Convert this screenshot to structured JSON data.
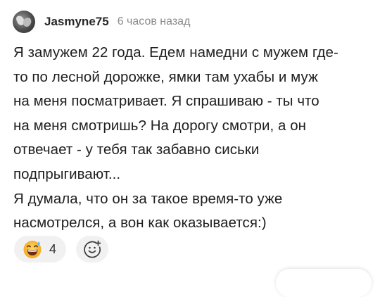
{
  "comment": {
    "author": "Jasmyne75",
    "time_ago": "6 часов назад",
    "text_lines": [
      "Я замужем 22 года. Едем намедни с мужем где-",
      "то по лесной дорожке, ямки там ухабы и муж",
      "на меня посматривает. Я спрашиваю - ты что",
      "на меня смотришь? На дорогу смотри, а он",
      "отвечает - у тебя так забавно сиськи",
      "подпрыгивают...",
      "Я думала, что он за такое время-то уже",
      "насмотрелся, а вон как оказывается:)"
    ]
  },
  "reactions": {
    "items": [
      {
        "icon": "grinning-sweat-emoji-icon",
        "count": "4"
      }
    ],
    "add_icon": "add-reaction-smiley-icon"
  },
  "colors": {
    "text": "#1f1f1f",
    "muted": "#8a8a8a",
    "pill_bg": "#f1f1f1",
    "emoji_yellow": "#ffc93c"
  }
}
